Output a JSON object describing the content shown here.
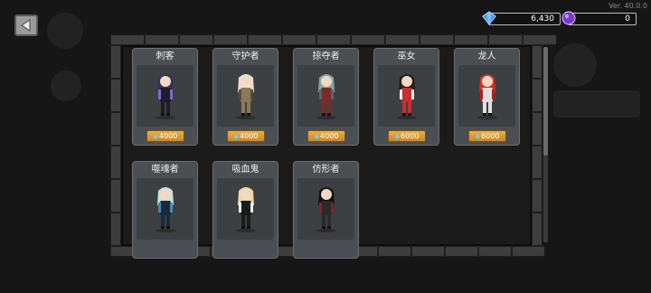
{
  "version": "Ver. 40.0.0",
  "header": {
    "back_icon": "back-arrow-icon",
    "gems": {
      "value": "6,430",
      "icon": "gem-icon"
    },
    "orbs": {
      "value": "0",
      "icon": "purple-orb-icon"
    }
  },
  "classes": [
    {
      "name": "刺客",
      "price": "4000",
      "colors": {
        "hair": "#3a2f5a",
        "body": "#1d1d2a",
        "accent": "#7a6bd0"
      }
    },
    {
      "name": "守护者",
      "price": "4000",
      "colors": {
        "hair": "#e8e0d0",
        "body": "#8a7a5a",
        "accent": "#5a4a3a"
      }
    },
    {
      "name": "掠夺者",
      "price": "4000",
      "colors": {
        "hair": "#8aa6a6",
        "body": "#7a2a2a",
        "accent": "#4a6a6a"
      }
    },
    {
      "name": "巫女",
      "price": "6000",
      "colors": {
        "hair": "#2a1a1a",
        "body": "#c83030",
        "accent": "#f0f0f0"
      }
    },
    {
      "name": "龙人",
      "price": "6000",
      "colors": {
        "hair": "#d0302a",
        "body": "#e0e0e0",
        "accent": "#b02020"
      }
    },
    {
      "name": "噬魂者",
      "price": "",
      "colors": {
        "hair": "#c8e0e0",
        "body": "#1a2a3a",
        "accent": "#4a8aa8"
      }
    },
    {
      "name": "吸血鬼",
      "price": "",
      "colors": {
        "hair": "#f0d8a0",
        "body": "#1a1a1a",
        "accent": "#f0f0f0"
      }
    },
    {
      "name": "仿形者",
      "price": "",
      "colors": {
        "hair": "#111111",
        "body": "#2a2a2a",
        "accent": "#8a2020"
      }
    }
  ],
  "accent_colors": {
    "price_badge": "#d9a03c",
    "frame": "#3d3d3d"
  }
}
